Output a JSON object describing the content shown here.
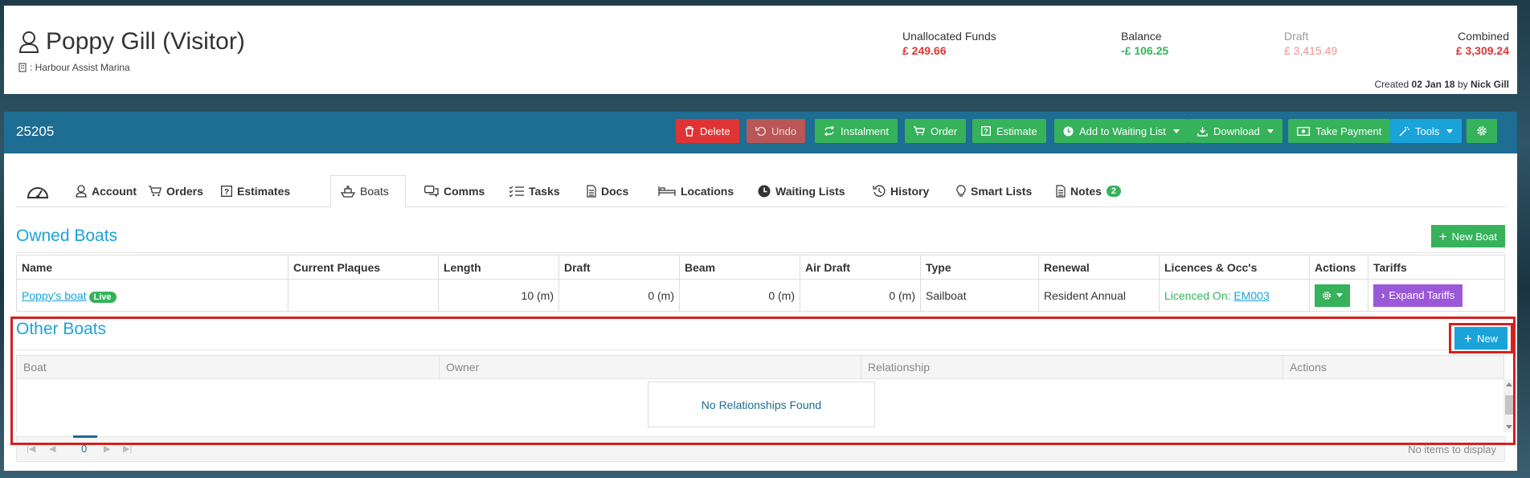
{
  "header": {
    "name": "Poppy Gill (Visitor)",
    "marina": ": Harbour Assist Marina",
    "funds": [
      {
        "label": "Unallocated Funds",
        "value": "£ 249.66",
        "color": "#e03434"
      },
      {
        "label": "Balance",
        "value": "-£ 106.25",
        "color": "#35b25a"
      },
      {
        "label": "Draft",
        "value": "£ 3,415.49",
        "color": "#f09090"
      },
      {
        "label": "Combined",
        "value": "£ 3,309.24",
        "color": "#e03434"
      }
    ],
    "created_prefix": "Created",
    "created_date": "02 Jan 18",
    "created_by_prefix": "by",
    "created_by": "Nick Gill"
  },
  "record": {
    "ref": "25205"
  },
  "toolbar": {
    "delete": "Delete",
    "undo": "Undo",
    "instalment": "Instalment",
    "order": "Order",
    "estimate": "Estimate",
    "waiting_list": "Add to Waiting List",
    "download": "Download",
    "take_payment": "Take Payment",
    "tools": "Tools"
  },
  "tabs": {
    "account": "Account",
    "orders": "Orders",
    "estimates": "Estimates",
    "boats": "Boats",
    "comms": "Comms",
    "tasks": "Tasks",
    "docs": "Docs",
    "locations": "Locations",
    "waiting_lists": "Waiting Lists",
    "history": "History",
    "smart_lists": "Smart Lists",
    "notes": "Notes",
    "notes_count": "2"
  },
  "owned": {
    "title": "Owned Boats",
    "new_button": "New Boat",
    "columns": [
      "Name",
      "Current Plaques",
      "Length",
      "Draft",
      "Beam",
      "Air Draft",
      "Type",
      "Renewal",
      "Licences & Occ's",
      "Actions",
      "Tariffs"
    ],
    "row": {
      "name": "Poppy's boat",
      "status": "Live",
      "plaques": "",
      "length": "10 (m)",
      "draft": "0 (m)",
      "beam": "0 (m)",
      "air_draft": "0 (m)",
      "type": "Sailboat",
      "renewal": "Resident Annual",
      "licence_label": "Licenced On:",
      "licence_code": "EM003",
      "tariffs_button": "Expand Tariffs"
    }
  },
  "other": {
    "title": "Other Boats",
    "new_button": "New",
    "columns": [
      "Boat",
      "Owner",
      "Relationship",
      "Actions"
    ],
    "empty": "No Relationships Found",
    "page": "0",
    "no_items": "No items to display"
  }
}
